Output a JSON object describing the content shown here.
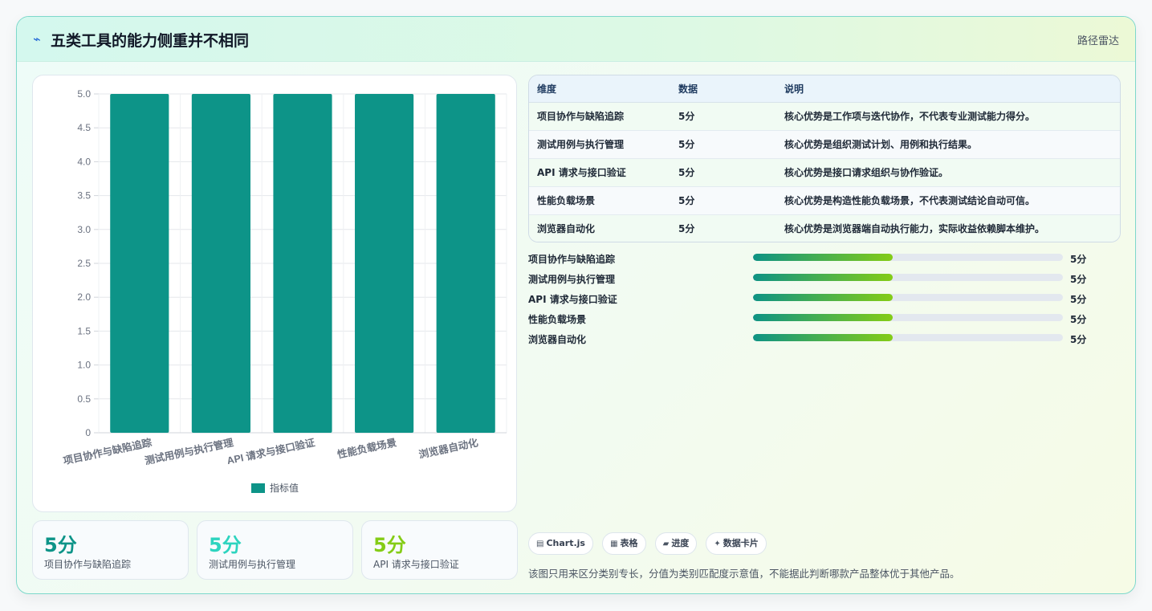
{
  "header": {
    "icon": "pulse-icon",
    "title": "五类工具的能力侧重并不相同",
    "right_label": "路径雷达"
  },
  "chart_data": {
    "type": "bar",
    "categories": [
      "项目协作与缺陷追踪",
      "测试用例与执行管理",
      "API 请求与接口验证",
      "性能负载场景",
      "浏览器自动化"
    ],
    "series": [
      {
        "name": "指标值",
        "values": [
          5,
          5,
          5,
          5,
          5
        ]
      }
    ],
    "ylim": [
      0,
      5
    ],
    "yticks": [
      "0",
      "0.5",
      "1.0",
      "1.5",
      "2.0",
      "2.5",
      "3.0",
      "3.5",
      "4.0",
      "4.5",
      "5.0"
    ],
    "legend_position": "bottom",
    "grid": true,
    "bar_color": "#0d9488"
  },
  "kpis": [
    {
      "value": "5分",
      "label": "项目协作与缺陷追踪",
      "color": "#0d9488"
    },
    {
      "value": "5分",
      "label": "测试用例与执行管理",
      "color": "#2dd4bf"
    },
    {
      "value": "5分",
      "label": "API 请求与接口验证",
      "color": "#84cc16"
    }
  ],
  "table": {
    "headers": [
      "维度",
      "数据",
      "说明"
    ],
    "rows": [
      [
        "项目协作与缺陷追踪",
        "5分",
        "核心优势是工作项与迭代协作，不代表专业测试能力得分。"
      ],
      [
        "测试用例与执行管理",
        "5分",
        "核心优势是组织测试计划、用例和执行结果。"
      ],
      [
        "API 请求与接口验证",
        "5分",
        "核心优势是接口请求组织与协作验证。"
      ],
      [
        "性能负载场景",
        "5分",
        "核心优势是构造性能负载场景，不代表测试结论自动可信。"
      ],
      [
        "浏览器自动化",
        "5分",
        "核心优势是浏览器端自动执行能力，实际收益依赖脚本维护。"
      ]
    ]
  },
  "progress": [
    {
      "label": "项目协作与缺陷追踪",
      "value": "5分",
      "fraction": 0.45
    },
    {
      "label": "测试用例与执行管理",
      "value": "5分",
      "fraction": 0.45
    },
    {
      "label": "API 请求与接口验证",
      "value": "5分",
      "fraction": 0.45
    },
    {
      "label": "性能负载场景",
      "value": "5分",
      "fraction": 0.45
    },
    {
      "label": "浏览器自动化",
      "value": "5分",
      "fraction": 0.45
    }
  ],
  "chips": [
    {
      "icon": "chart-icon",
      "glyph": "▤",
      "label": "Chart.js"
    },
    {
      "icon": "table-icon",
      "glyph": "▦",
      "label": "表格"
    },
    {
      "icon": "progress-icon",
      "glyph": "▰",
      "label": "进度"
    },
    {
      "icon": "sparkle-icon",
      "glyph": "✦",
      "label": "数据卡片"
    }
  ],
  "footnote": "该图只用来区分类别专长，分值为类别匹配度示意值，不能据此判断哪款产品整体优于其他产品。"
}
